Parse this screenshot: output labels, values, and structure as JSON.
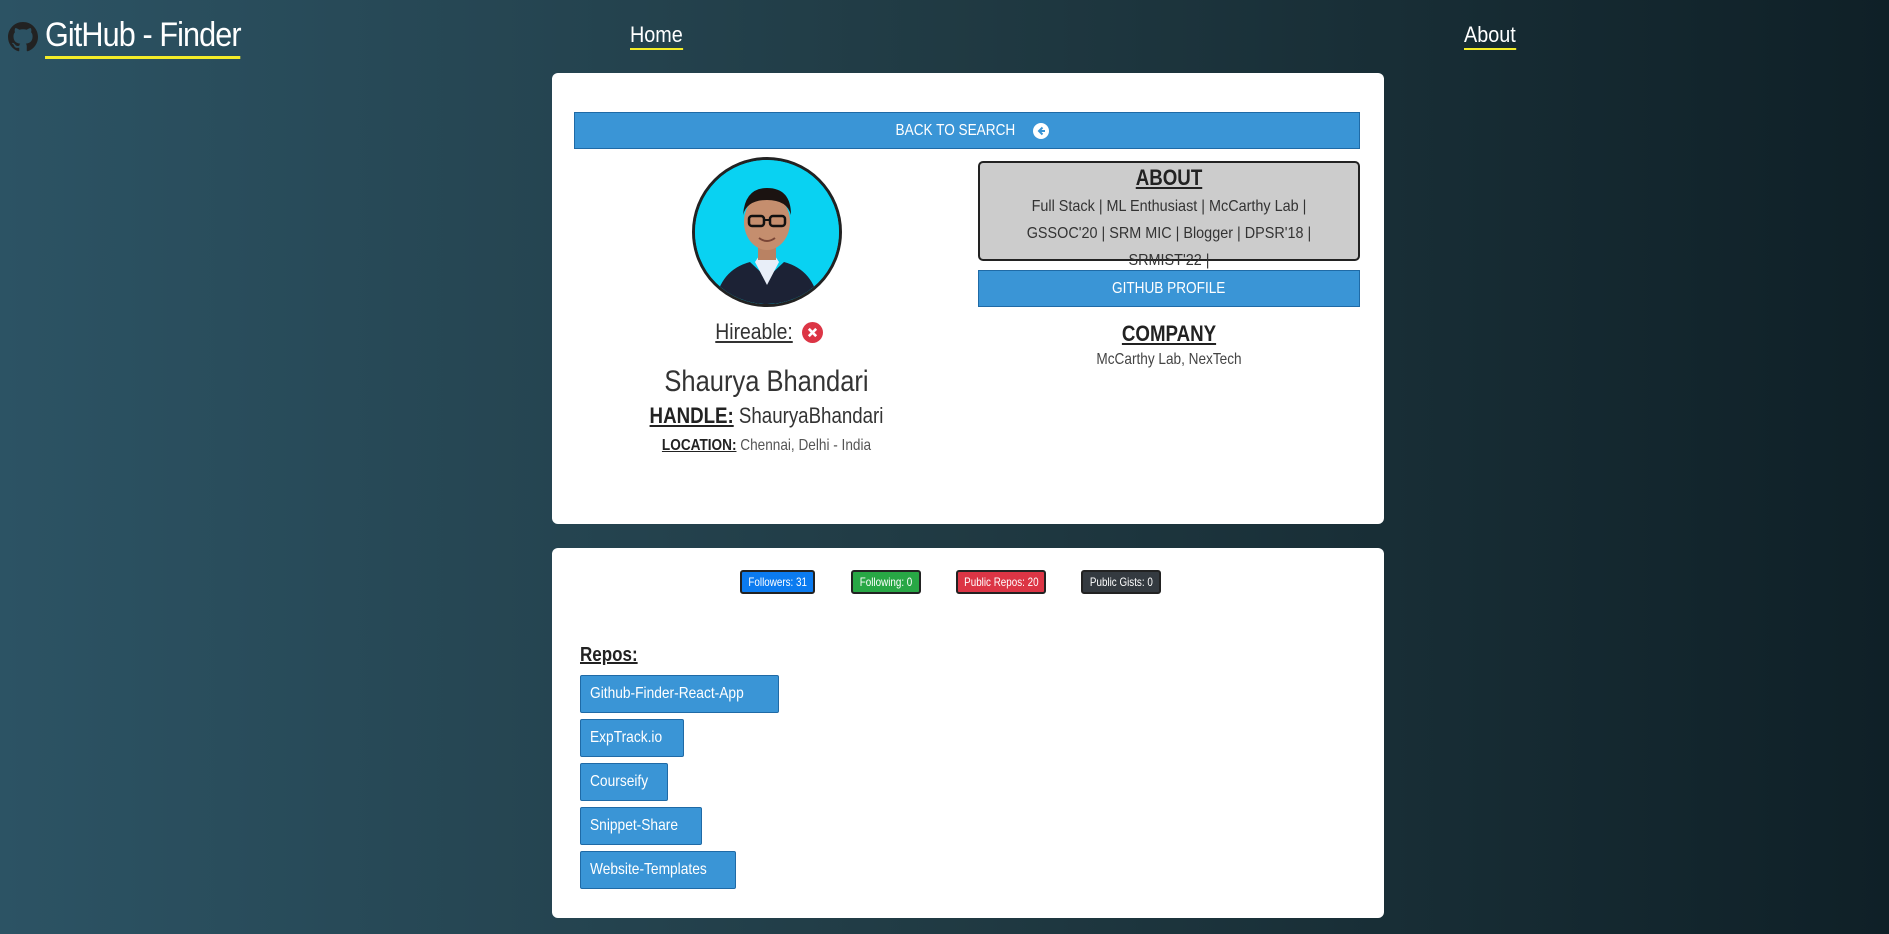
{
  "header": {
    "brand_title": "GitHub - Finder",
    "brand_icon": "github-icon",
    "nav": [
      {
        "label": "Home"
      },
      {
        "label": "About"
      }
    ]
  },
  "profile": {
    "back_label": "BACK TO SEARCH",
    "back_icon": "arrow-circle-left-icon",
    "hireable_label": "Hireable:",
    "hireable_icon": "x-circle-icon",
    "name": "Shaurya Bhandari",
    "handle_label": "HANDLE:",
    "handle_value": "ShauryaBhandari",
    "location_label": "LOCATION:",
    "location_value": "Chennai, Delhi - India",
    "about_title": "ABOUT",
    "about_bio": "Full Stack | ML Enthusiast | McCarthy Lab | GSSOC'20 | SRM MIC | Blogger | DPSR'18 | SRMIST'22 |",
    "github_profile_label": "GITHUB PROFILE",
    "company_title": "COMPANY",
    "company_value": "McCarthy Lab, NexTech"
  },
  "stats": {
    "followers": "Followers: 31",
    "following": "Following: 0",
    "public_repos": "Public Repos: 20",
    "public_gists": "Public Gists: 0",
    "colors": {
      "followers": "#0b7bf0",
      "following": "#28a745",
      "repos": "#dc3545",
      "gists": "#343a40"
    }
  },
  "repos": {
    "title": "Repos:",
    "items": [
      {
        "name": "Github-Finder-React-App"
      },
      {
        "name": "ExpTrack.io"
      },
      {
        "name": "Courseify"
      },
      {
        "name": "Snippet-Share"
      },
      {
        "name": "Website-Templates"
      }
    ]
  },
  "theme": {
    "accent": "#3a95d6",
    "underline": "#f4ec28"
  }
}
